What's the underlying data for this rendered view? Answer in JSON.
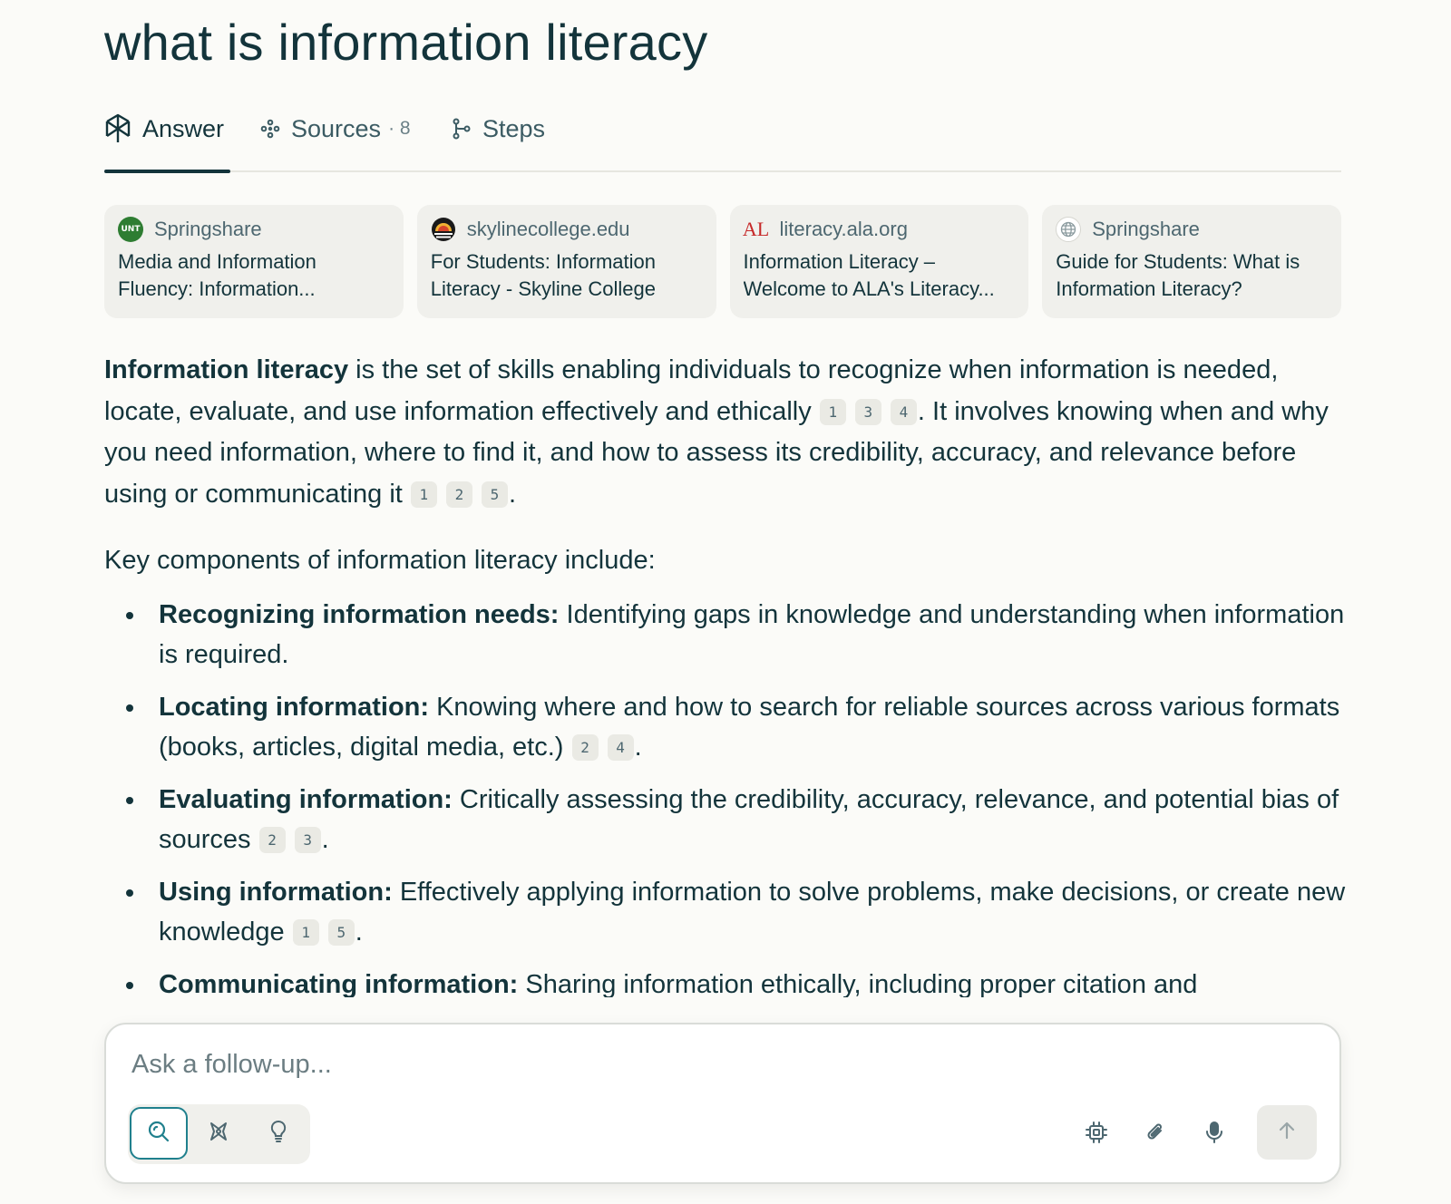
{
  "query": {
    "title": "what is information literacy"
  },
  "tabs": [
    {
      "label": "Answer",
      "icon": "perplexity-logo-icon",
      "active": true
    },
    {
      "label": "Sources",
      "count": "· 8",
      "icon": "sources-icon"
    },
    {
      "label": "Steps",
      "icon": "steps-icon"
    }
  ],
  "source_cards": [
    {
      "domain": "Springshare",
      "title": "Media and Information Fluency: Information...",
      "favicon": "unt-logo-icon",
      "favicon_color": "#2e7d32",
      "favicon_text": "UNT"
    },
    {
      "domain": "skylinecollege.edu",
      "title": "For Students: Information Literacy - Skyline College",
      "favicon": "skyline-logo-icon"
    },
    {
      "domain": "literacy.ala.org",
      "title": "Information Literacy – Welcome to ALA's Literacy...",
      "favicon": "ala-logo-icon",
      "favicon_color": "#c62828",
      "favicon_text": "AL"
    },
    {
      "domain": "Springshare",
      "title": "Guide for Students: What is Information Literacy?",
      "favicon": "globe-icon"
    }
  ],
  "answer": {
    "p1": {
      "bold": "Information literacy",
      "text1": " is the set of skills enabling individuals to recognize when information is needed, locate, evaluate, and use information effectively and ethically ",
      "cites1": [
        "1",
        "3",
        "4"
      ],
      "text2": ". It involves knowing when and why you need information, where to find it, and how to assess its credibility, accuracy, and relevance before using or communicating it ",
      "cites2": [
        "1",
        "2",
        "5"
      ],
      "text3": "."
    },
    "intro": "Key components of information literacy include:",
    "components": [
      {
        "term": "Recognizing information needs:",
        "desc": " Identifying gaps in knowledge and understanding when information is required.",
        "cites": []
      },
      {
        "term": "Locating information:",
        "desc": " Knowing where and how to search for reliable sources across various formats (books, articles, digital media, etc.) ",
        "cites": [
          "2",
          "4"
        ]
      },
      {
        "term": "Evaluating information:",
        "desc": " Critically assessing the credibility, accuracy, relevance, and potential bias of sources ",
        "cites": [
          "2",
          "3"
        ]
      },
      {
        "term": "Using information:",
        "desc": " Effectively applying information to solve problems, make decisions, or create new knowledge ",
        "cites": [
          "1",
          "5"
        ]
      },
      {
        "term": "Communicating information:",
        "desc": " Sharing information ethically, including proper citation and",
        "cites": []
      }
    ]
  },
  "composer": {
    "placeholder": "Ask a follow-up...",
    "modes": [
      "search-icon",
      "research-icon",
      "lightbulb-icon"
    ],
    "tools": [
      "chip-icon",
      "paperclip-icon",
      "microphone-icon"
    ],
    "send": "arrow-up-icon"
  },
  "colors": {
    "accent": "#20808d",
    "text": "#13343b",
    "card_bg": "#f0f0ec",
    "page_bg": "#fbfbf8"
  }
}
